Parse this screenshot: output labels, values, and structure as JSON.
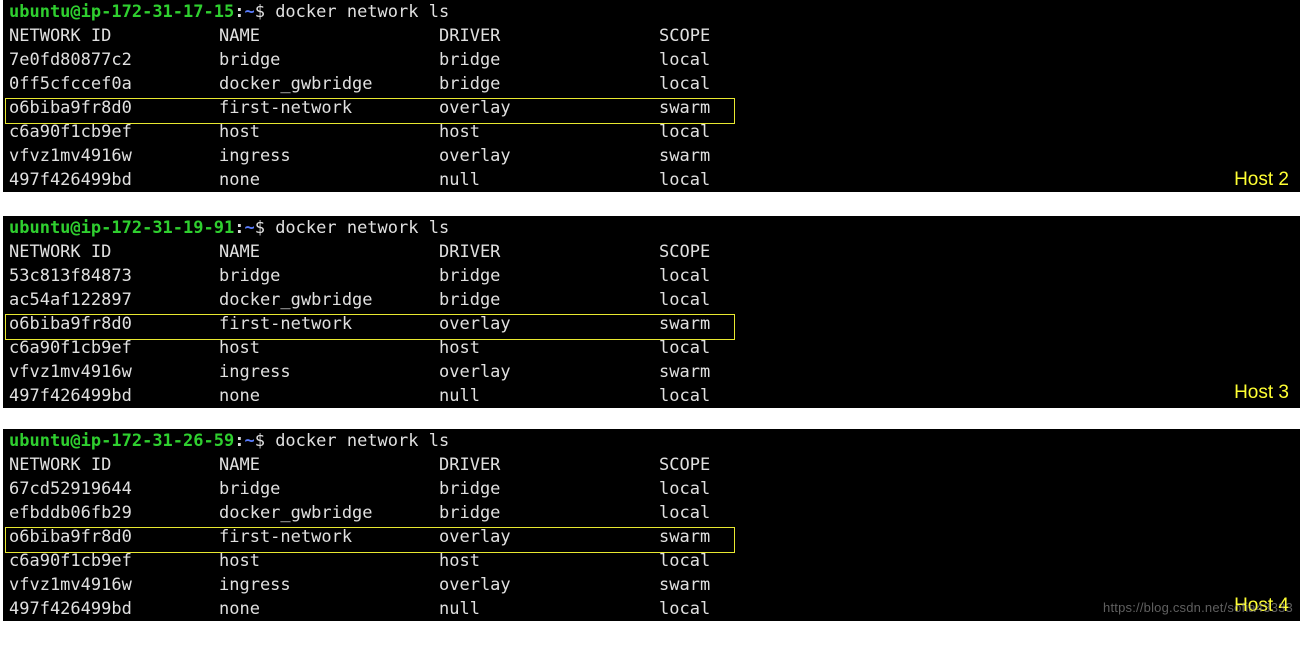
{
  "watermark": "https://blog.csdn.net/sofia43333",
  "terminals": [
    {
      "label": "Host 2",
      "prompt": {
        "user": "ubuntu",
        "host": "ip-172-31-17-15",
        "path": "~",
        "command": "docker network ls"
      },
      "headers": {
        "id": "NETWORK ID",
        "name": "NAME",
        "driver": "DRIVER",
        "scope": "SCOPE"
      },
      "highlight_index": 2,
      "rows": [
        {
          "id": "7e0fd80877c2",
          "name": "bridge",
          "driver": "bridge",
          "scope": "local"
        },
        {
          "id": "0ff5cfccef0a",
          "name": "docker_gwbridge",
          "driver": "bridge",
          "scope": "local"
        },
        {
          "id": "o6biba9fr8d0",
          "name": "first-network",
          "driver": "overlay",
          "scope": "swarm"
        },
        {
          "id": "c6a90f1cb9ef",
          "name": "host",
          "driver": "host",
          "scope": "local"
        },
        {
          "id": "vfvz1mv4916w",
          "name": "ingress",
          "driver": "overlay",
          "scope": "swarm"
        },
        {
          "id": "497f426499bd",
          "name": "none",
          "driver": "null",
          "scope": "local"
        }
      ]
    },
    {
      "label": "Host 3",
      "prompt": {
        "user": "ubuntu",
        "host": "ip-172-31-19-91",
        "path": "~",
        "command": "docker network ls"
      },
      "headers": {
        "id": "NETWORK ID",
        "name": "NAME",
        "driver": "DRIVER",
        "scope": "SCOPE"
      },
      "highlight_index": 2,
      "rows": [
        {
          "id": "53c813f84873",
          "name": "bridge",
          "driver": "bridge",
          "scope": "local"
        },
        {
          "id": "ac54af122897",
          "name": "docker_gwbridge",
          "driver": "bridge",
          "scope": "local"
        },
        {
          "id": "o6biba9fr8d0",
          "name": "first-network",
          "driver": "overlay",
          "scope": "swarm"
        },
        {
          "id": "c6a90f1cb9ef",
          "name": "host",
          "driver": "host",
          "scope": "local"
        },
        {
          "id": "vfvz1mv4916w",
          "name": "ingress",
          "driver": "overlay",
          "scope": "swarm"
        },
        {
          "id": "497f426499bd",
          "name": "none",
          "driver": "null",
          "scope": "local"
        }
      ]
    },
    {
      "label": "Host 4",
      "prompt": {
        "user": "ubuntu",
        "host": "ip-172-31-26-59",
        "path": "~",
        "command": "docker network ls"
      },
      "headers": {
        "id": "NETWORK ID",
        "name": "NAME",
        "driver": "DRIVER",
        "scope": "SCOPE"
      },
      "highlight_index": 2,
      "rows": [
        {
          "id": "67cd52919644",
          "name": "bridge",
          "driver": "bridge",
          "scope": "local"
        },
        {
          "id": "efbddb06fb29",
          "name": "docker_gwbridge",
          "driver": "bridge",
          "scope": "local"
        },
        {
          "id": "o6biba9fr8d0",
          "name": "first-network",
          "driver": "overlay",
          "scope": "swarm"
        },
        {
          "id": "c6a90f1cb9ef",
          "name": "host",
          "driver": "host",
          "scope": "local"
        },
        {
          "id": "vfvz1mv4916w",
          "name": "ingress",
          "driver": "overlay",
          "scope": "swarm"
        },
        {
          "id": "497f426499bd",
          "name": "none",
          "driver": "null",
          "scope": "local"
        }
      ]
    }
  ]
}
